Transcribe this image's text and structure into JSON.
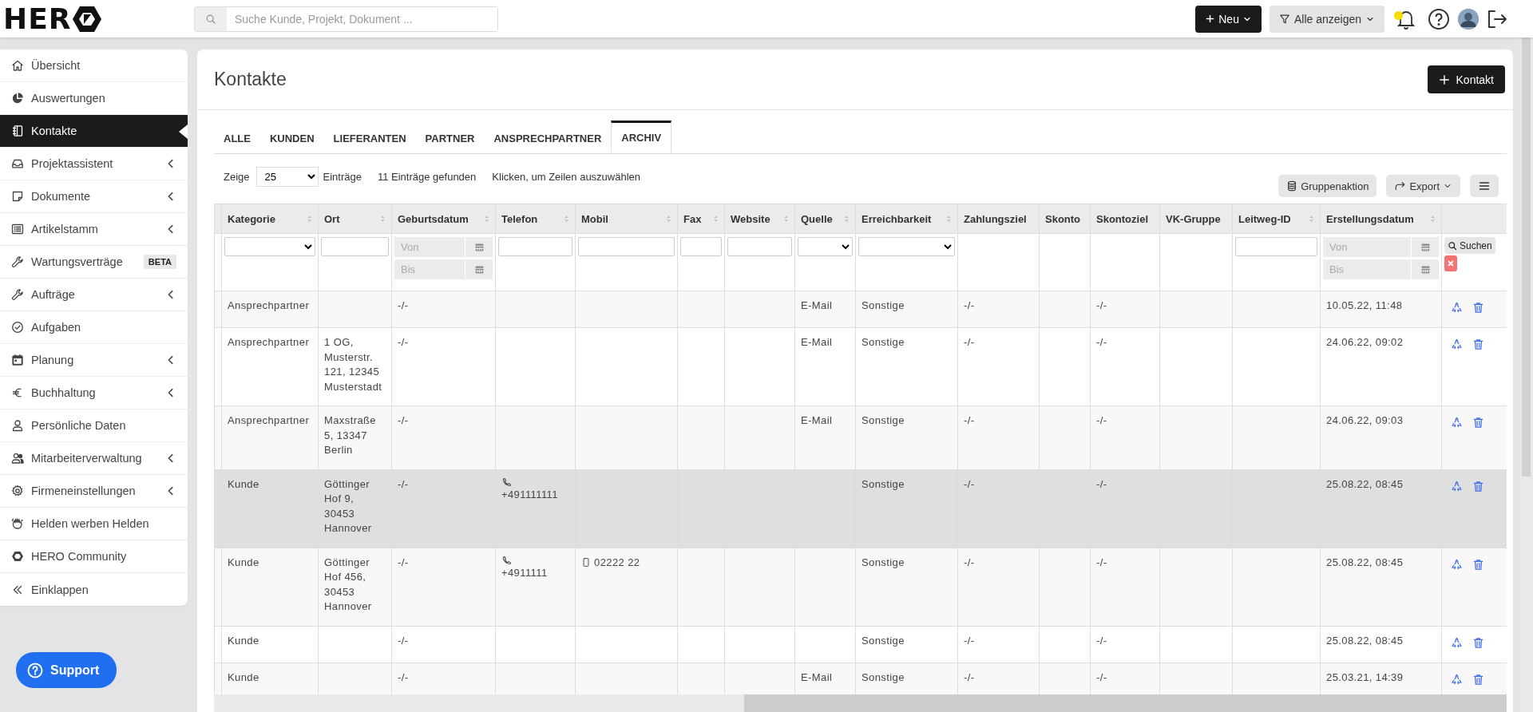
{
  "header": {
    "logo_text": "HER",
    "search": {
      "placeholder": "Suche Kunde, Projekt, Dokument ..."
    },
    "new_button": "Neu",
    "filter_button": "Alle anzeigen",
    "notification_dot": true
  },
  "sidebar": {
    "items": [
      {
        "label": "Übersicht",
        "selected": false,
        "expandable": false
      },
      {
        "label": "Auswertungen",
        "selected": false,
        "expandable": false
      },
      {
        "label": "Kontakte",
        "selected": true,
        "expandable": false
      },
      {
        "label": "Projektassistent",
        "selected": false,
        "expandable": true
      },
      {
        "label": "Dokumente",
        "selected": false,
        "expandable": true
      },
      {
        "label": "Artikelstamm",
        "selected": false,
        "expandable": true
      },
      {
        "label": "Wartungsverträge",
        "selected": false,
        "expandable": false,
        "badge": "BETA"
      },
      {
        "label": "Aufträge",
        "selected": false,
        "expandable": true
      },
      {
        "label": "Aufgaben",
        "selected": false,
        "expandable": false
      },
      {
        "label": "Planung",
        "selected": false,
        "expandable": true
      },
      {
        "label": "Buchhaltung",
        "selected": false,
        "expandable": true
      },
      {
        "label": "Persönliche Daten",
        "selected": false,
        "expandable": false
      },
      {
        "label": "Mitarbeiterverwaltung",
        "selected": false,
        "expandable": true
      },
      {
        "label": "Firmeneinstellungen",
        "selected": false,
        "expandable": true
      },
      {
        "label": "Helden werben Helden",
        "selected": false,
        "expandable": false
      },
      {
        "label": "HERO Community",
        "selected": false,
        "expandable": false
      },
      {
        "label": "Einklappen",
        "selected": false,
        "expandable": false
      }
    ]
  },
  "support_button": "Support",
  "page": {
    "title": "Kontakte",
    "add_button": "Kontakt"
  },
  "tabs": [
    {
      "label": "ALLE",
      "selected": false
    },
    {
      "label": "KUNDEN",
      "selected": false
    },
    {
      "label": "LIEFERANTEN",
      "selected": false
    },
    {
      "label": "PARTNER",
      "selected": false
    },
    {
      "label": "ANSPRECHPARTNER",
      "selected": false
    },
    {
      "label": "ARCHIV",
      "selected": true
    }
  ],
  "toolbar": {
    "show_label": "Zeige",
    "page_size": "25",
    "entries_label": "Einträge",
    "found": "11 Einträge gefunden",
    "hint": "Klicken, um Zeilen auszuwählen",
    "group_action": "Gruppenaktion",
    "export": "Export"
  },
  "table": {
    "search_button": "Suchen",
    "columns": [
      {
        "label": "Kategorie",
        "sortable": true,
        "kind": "text",
        "filter": {
          "kind": "select"
        }
      },
      {
        "label": "Ort",
        "sortable": true,
        "kind": "text",
        "filter": {
          "kind": "text"
        }
      },
      {
        "label": "Geburtsdatum",
        "sortable": true,
        "kind": "text",
        "filter": {
          "kind": "daterange",
          "from_placeholder": "Von",
          "to_placeholder": "Bis"
        }
      },
      {
        "label": "Telefon",
        "sortable": true,
        "kind": "phone",
        "filter": {
          "kind": "text"
        }
      },
      {
        "label": "Mobil",
        "sortable": true,
        "kind": "mobile",
        "filter": {
          "kind": "text"
        }
      },
      {
        "label": "Fax",
        "sortable": true,
        "kind": "text",
        "filter": {
          "kind": "text"
        }
      },
      {
        "label": "Website",
        "sortable": true,
        "kind": "text",
        "filter": {
          "kind": "text"
        }
      },
      {
        "label": "Quelle",
        "sortable": true,
        "kind": "text",
        "filter": {
          "kind": "select"
        }
      },
      {
        "label": "Erreichbarkeit",
        "sortable": true,
        "kind": "text",
        "filter": {
          "kind": "select"
        }
      },
      {
        "label": "Zahlungsziel",
        "sortable": false,
        "kind": "text",
        "filter": {
          "kind": "none"
        }
      },
      {
        "label": "Skonto",
        "sortable": false,
        "kind": "text",
        "filter": {
          "kind": "none"
        }
      },
      {
        "label": "Skontoziel",
        "sortable": false,
        "kind": "text",
        "filter": {
          "kind": "none"
        }
      },
      {
        "label": "VK-Gruppe",
        "sortable": false,
        "kind": "text",
        "filter": {
          "kind": "none"
        }
      },
      {
        "label": "Leitweg-ID",
        "sortable": true,
        "kind": "text",
        "filter": {
          "kind": "text"
        }
      },
      {
        "label": "Erstellungsdatum",
        "sortable": true,
        "kind": "text",
        "filter": {
          "kind": "daterange",
          "from_placeholder": "Von",
          "to_placeholder": "Bis"
        }
      }
    ],
    "rows": [
      {
        "highlighted": false,
        "cells": [
          "Ansprechpartner",
          null,
          "-/-",
          null,
          null,
          null,
          null,
          "E-Mail",
          "Sonstige",
          "-/-",
          null,
          "-/-",
          null,
          null,
          "10.05.22, 11:48"
        ]
      },
      {
        "highlighted": false,
        "cells": [
          "Ansprechpartner",
          "1 OG, Musterstr. 121, 12345 Musterstadt",
          "-/-",
          null,
          null,
          null,
          null,
          "E-Mail",
          "Sonstige",
          "-/-",
          null,
          "-/-",
          null,
          null,
          "24.06.22, 09:02"
        ]
      },
      {
        "highlighted": false,
        "cells": [
          "Ansprechpartner",
          "Maxstraße 5, 13347 Berlin",
          "-/-",
          null,
          null,
          null,
          null,
          "E-Mail",
          "Sonstige",
          "-/-",
          null,
          "-/-",
          null,
          null,
          "24.06.22, 09:03"
        ]
      },
      {
        "highlighted": true,
        "cells": [
          "Kunde",
          "Göttinger Hof 9, 30453 Hannover",
          "-/-",
          "+491111111",
          null,
          null,
          null,
          null,
          "Sonstige",
          "-/-",
          null,
          "-/-",
          null,
          null,
          "25.08.22, 08:45"
        ]
      },
      {
        "highlighted": false,
        "cells": [
          "Kunde",
          "Göttinger Hof 456, 30453 Hannover",
          "-/-",
          "+4911111",
          "02222 22",
          null,
          null,
          null,
          "Sonstige",
          "-/-",
          null,
          "-/-",
          null,
          null,
          "25.08.22, 08:45"
        ]
      },
      {
        "highlighted": false,
        "cells": [
          "Kunde",
          null,
          "-/-",
          null,
          null,
          null,
          null,
          null,
          "Sonstige",
          "-/-",
          null,
          "-/-",
          null,
          null,
          "25.08.22, 08:45"
        ]
      },
      {
        "highlighted": false,
        "cells": [
          "Kunde",
          null,
          "-/-",
          null,
          null,
          null,
          null,
          "E-Mail",
          "Sonstige",
          "-/-",
          null,
          "-/-",
          null,
          null,
          "25.03.21, 14:39"
        ]
      }
    ]
  }
}
